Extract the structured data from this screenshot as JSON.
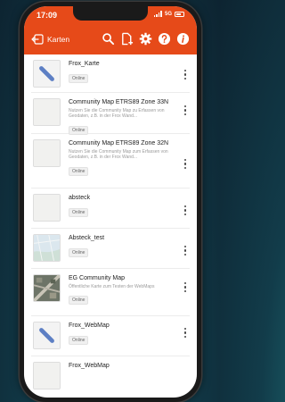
{
  "status": {
    "time": "17:09",
    "network": "5G"
  },
  "toolbar": {
    "title": "Karten",
    "icons": [
      "back-arrow-icon",
      "search-icon",
      "add-file-icon",
      "gear-icon",
      "help-icon",
      "info-icon"
    ]
  },
  "colors": {
    "accent": "#e64a19"
  },
  "maps": [
    {
      "name": "Frox_Karte",
      "desc": "",
      "status": "Online",
      "thumb": "blue-bar"
    },
    {
      "name": "Community Map ETRS89 Zone 33N",
      "desc": "Nutzen Sie die Community Map zu Erfassen von Geodaten, z.B. in der Frox Wand...",
      "status": "Online",
      "thumb": "blank"
    },
    {
      "name": "Community Map ETRS89 Zone 32N",
      "desc": "Nutzen Sie die Community Map zum Erfassen von Geodaten, z.B. in der Frox Wand...",
      "status": "Online",
      "thumb": "blank"
    },
    {
      "name": "absteck",
      "desc": "",
      "status": "Online",
      "thumb": "blank"
    },
    {
      "name": "Absteck_test",
      "desc": "",
      "status": "Online",
      "thumb": "light-map"
    },
    {
      "name": "EG Community Map",
      "desc": "Öffentliche Karte zum Testen der WebMaps",
      "status": "Online",
      "thumb": "aerial"
    },
    {
      "name": "Frox_WebMap",
      "desc": "",
      "status": "Online",
      "thumb": "blue-bar"
    },
    {
      "name": "Frox_WebMap",
      "desc": "",
      "status": "",
      "thumb": "blank"
    }
  ]
}
